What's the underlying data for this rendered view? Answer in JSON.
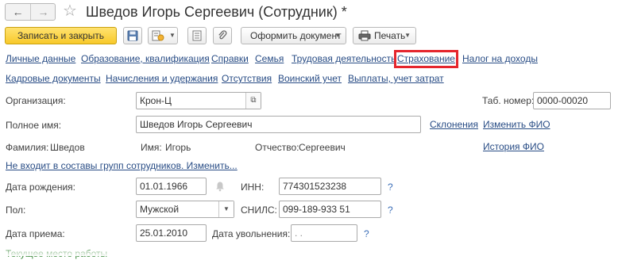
{
  "window": {
    "title": "Шведов Игорь Сергеевич (Сотрудник) *"
  },
  "toolbar": {
    "save_close_label": "Записать и закрыть",
    "create_document_label": "Оформить документ",
    "print_label": "Печать"
  },
  "nav_links": {
    "row1": [
      "Личные данные",
      "Образование, квалификация",
      "Справки",
      "Семья",
      "Трудовая деятельность",
      "Страхование",
      "Налог на доходы"
    ],
    "row2": [
      "Кадровые документы",
      "Начисления и удержания",
      "Отсутствия",
      "Воинский учет",
      "Выплаты, учет затрат"
    ]
  },
  "form": {
    "organization_label": "Организация:",
    "organization_value": "Крон-Ц",
    "tab_number_label": "Таб. номер:",
    "tab_number_value": "0000-00020",
    "full_name_label": "Полное имя:",
    "full_name_value": "Шведов Игорь Сергеевич",
    "declensions_link": "Склонения",
    "change_name_link": "Изменить ФИО",
    "surname_label": "Фамилия:",
    "surname_value": "Шведов",
    "name_label": "Имя:",
    "name_value": "Игорь",
    "patronymic_label": "Отчество:",
    "patronymic_value": "Сергеевич",
    "name_history_link": "История ФИО",
    "groups_link": "Не входит в составы групп сотрудников. Изменить...",
    "birth_date_label": "Дата рождения:",
    "birth_date_value": "01.01.1966",
    "inn_label": "ИНН:",
    "inn_value": "774301523238",
    "gender_label": "Пол:",
    "gender_value": "Мужской",
    "snils_label": "СНИЛС:",
    "snils_value": "099-189-933 51",
    "hire_date_label": "Дата приема:",
    "hire_date_value": "25.01.2010",
    "dismissal_date_label": "Дата увольнения:",
    "dismissal_date_value": " .  .",
    "help_mark": "?",
    "current_job_label": "Текущее место работы"
  },
  "colors": {
    "link": "#284c85",
    "highlight": "#e5262d",
    "primary_button": "#f8c92a",
    "section_green": "#3c8a3c"
  }
}
